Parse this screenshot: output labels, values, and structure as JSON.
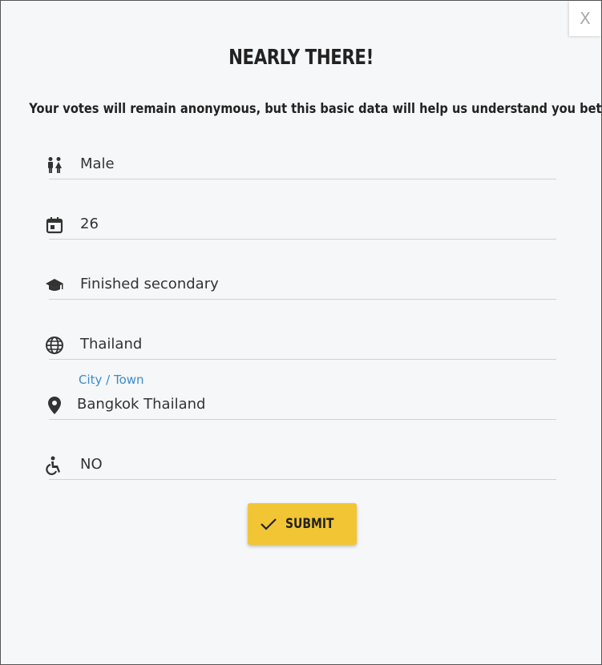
{
  "dialog": {
    "close_label": "X",
    "title": "NEARLY THERE!",
    "subtitle": "Your votes will remain anonymous, but this basic data will help us understand you better."
  },
  "fields": {
    "gender": {
      "value": "Male",
      "icon": "gender-icon"
    },
    "age": {
      "value": "26",
      "icon": "calendar-icon"
    },
    "education": {
      "value": "Finished secondary",
      "icon": "graduation-cap-icon"
    },
    "country": {
      "value": "Thailand",
      "icon": "globe-icon"
    },
    "city": {
      "label": "City / Town",
      "value": "Bangkok Thailand",
      "icon": "location-pin-icon"
    },
    "disability": {
      "value": "NO",
      "icon": "accessibility-icon"
    }
  },
  "submit": {
    "label": "SUBMIT",
    "icon": "check-icon"
  },
  "colors": {
    "accent": "#f2c534",
    "label_blue": "#3f8bc9",
    "background": "#f5f7f9"
  }
}
